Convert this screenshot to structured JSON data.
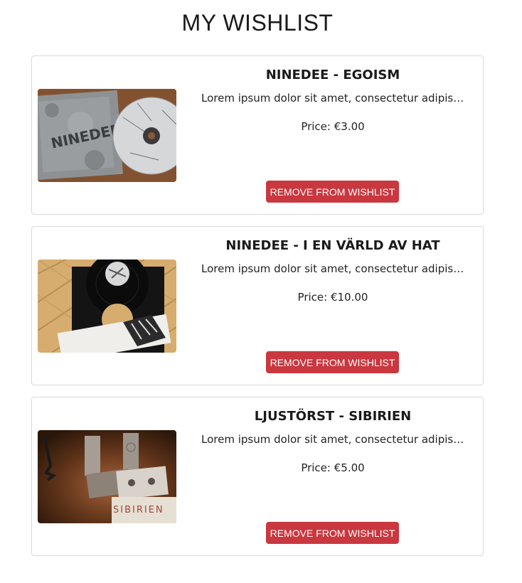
{
  "page": {
    "title": "MY WISHLIST"
  },
  "wishlist": {
    "items": [
      {
        "title": "NINEDEE - EGOISM",
        "description": "Lorem ipsum dolor sit amet, consectetur adipiscing elit, sed do eiusmod tempor incididunt",
        "price": "Price: €3.00",
        "button_label": "REMOVE FROM WISHLIST",
        "image_text": "NINEDEE"
      },
      {
        "title": "NINEDEE - I EN VÄRLD AV HAT",
        "description": "Lorem ipsum dolor sit amet, consectetur adipiscing elit, sed do eiusmod tempor incididunt",
        "price": "Price: €10.00",
        "button_label": "REMOVE FROM WISHLIST"
      },
      {
        "title": "LJUSTÖRST - SIBIRIEN",
        "description": "Lorem ipsum dolor sit amet, consectetur adipiscing elit, sed do eiusmod tempor incididunt",
        "price": "Price: €5.00",
        "button_label": "REMOVE FROM WISHLIST",
        "image_text": "SIBIRIEN"
      }
    ]
  },
  "colors": {
    "button_bg": "#c9373f",
    "card_border": "#d9d9d9"
  }
}
